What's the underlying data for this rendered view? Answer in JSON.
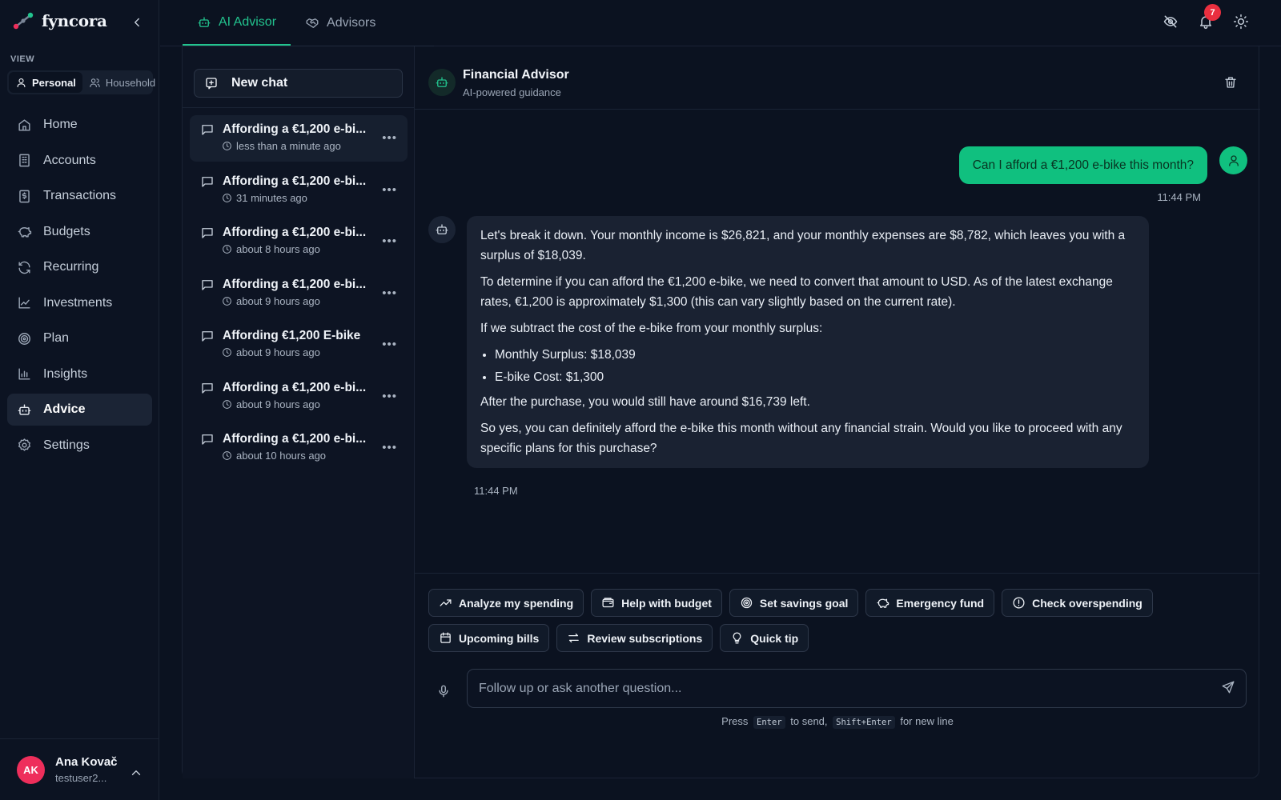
{
  "app": {
    "name": "fyncora"
  },
  "sidebar": {
    "view_label": "VIEW",
    "view_options": [
      {
        "label": "Personal",
        "active": true
      },
      {
        "label": "Household",
        "active": false
      }
    ],
    "items": [
      {
        "label": "Home",
        "icon": "home-icon"
      },
      {
        "label": "Accounts",
        "icon": "building-icon"
      },
      {
        "label": "Transactions",
        "icon": "receipt-icon"
      },
      {
        "label": "Budgets",
        "icon": "piggy-bank-icon"
      },
      {
        "label": "Recurring",
        "icon": "refresh-icon"
      },
      {
        "label": "Investments",
        "icon": "line-chart-icon"
      },
      {
        "label": "Plan",
        "icon": "target-icon"
      },
      {
        "label": "Insights",
        "icon": "bar-chart-icon"
      },
      {
        "label": "Advice",
        "icon": "bot-icon",
        "active": true
      },
      {
        "label": "Settings",
        "icon": "gear-icon"
      }
    ]
  },
  "user": {
    "initials": "AK",
    "name": "Ana Kovač",
    "handle": "testuser2...",
    "avatar_color": "#ee2e5b"
  },
  "header": {
    "tabs": [
      {
        "label": "AI Advisor",
        "active": true
      },
      {
        "label": "Advisors",
        "active": false
      }
    ],
    "notifications_count": "7"
  },
  "chat_list": {
    "new_chat_label": "New chat",
    "conversations": [
      {
        "title": "Affording a €1,200 e-bi...",
        "time": "less than a minute ago",
        "active": true
      },
      {
        "title": "Affording a €1,200 e-bi...",
        "time": "31 minutes ago"
      },
      {
        "title": "Affording a €1,200 e-bi...",
        "time": "about 8 hours ago"
      },
      {
        "title": "Affording a €1,200 e-bi...",
        "time": "about 9 hours ago"
      },
      {
        "title": "Affording €1,200 E-bike",
        "time": "about 9 hours ago"
      },
      {
        "title": "Affording a €1,200 e-bi...",
        "time": "about 9 hours ago"
      },
      {
        "title": "Affording a €1,200 e-bi...",
        "time": "about 10 hours ago"
      }
    ]
  },
  "chat": {
    "title": "Financial Advisor",
    "subtitle": "AI-powered guidance",
    "user_message": {
      "text": "Can I afford a €1,200 e-bike this month?",
      "time": "11:44 PM"
    },
    "ai_message": {
      "p1": "Let's break it down. Your monthly income is $26,821, and your monthly expenses are $8,782, which leaves you with a surplus of $18,039.",
      "p2": "To determine if you can afford the €1,200 e-bike, we need to convert that amount to USD. As of the latest exchange rates, €1,200 is approximately $1,300 (this can vary slightly based on the current rate).",
      "p3": "If we subtract the cost of the e-bike from your monthly surplus:",
      "bullets": [
        "Monthly Surplus: $18,039",
        "E-bike Cost: $1,300"
      ],
      "p4": "After the purchase, you would still have around $16,739 left.",
      "p5": "So yes, you can definitely afford the e-bike this month without any financial strain. Would you like to proceed with any specific plans for this purchase?",
      "time": "11:44 PM"
    }
  },
  "composer": {
    "chips": [
      {
        "label": "Analyze my spending",
        "icon": "trending-up-icon"
      },
      {
        "label": "Help with budget",
        "icon": "wallet-icon"
      },
      {
        "label": "Set savings goal",
        "icon": "target-icon"
      },
      {
        "label": "Emergency fund",
        "icon": "piggy-bank-icon"
      },
      {
        "label": "Check overspending",
        "icon": "alert-circle-icon"
      },
      {
        "label": "Upcoming bills",
        "icon": "calendar-icon"
      },
      {
        "label": "Review subscriptions",
        "icon": "arrows-swap-icon"
      },
      {
        "label": "Quick tip",
        "icon": "lightbulb-icon"
      }
    ],
    "placeholder": "Follow up or ask another question...",
    "hint_press": "Press",
    "hint_key1": "Enter",
    "hint_mid": "to send,",
    "hint_key2": "Shift+Enter",
    "hint_end": "for new line"
  },
  "colors": {
    "accent": "#22c38e",
    "user_bubble": "#10c07f",
    "badge": "#ea2f3f"
  }
}
